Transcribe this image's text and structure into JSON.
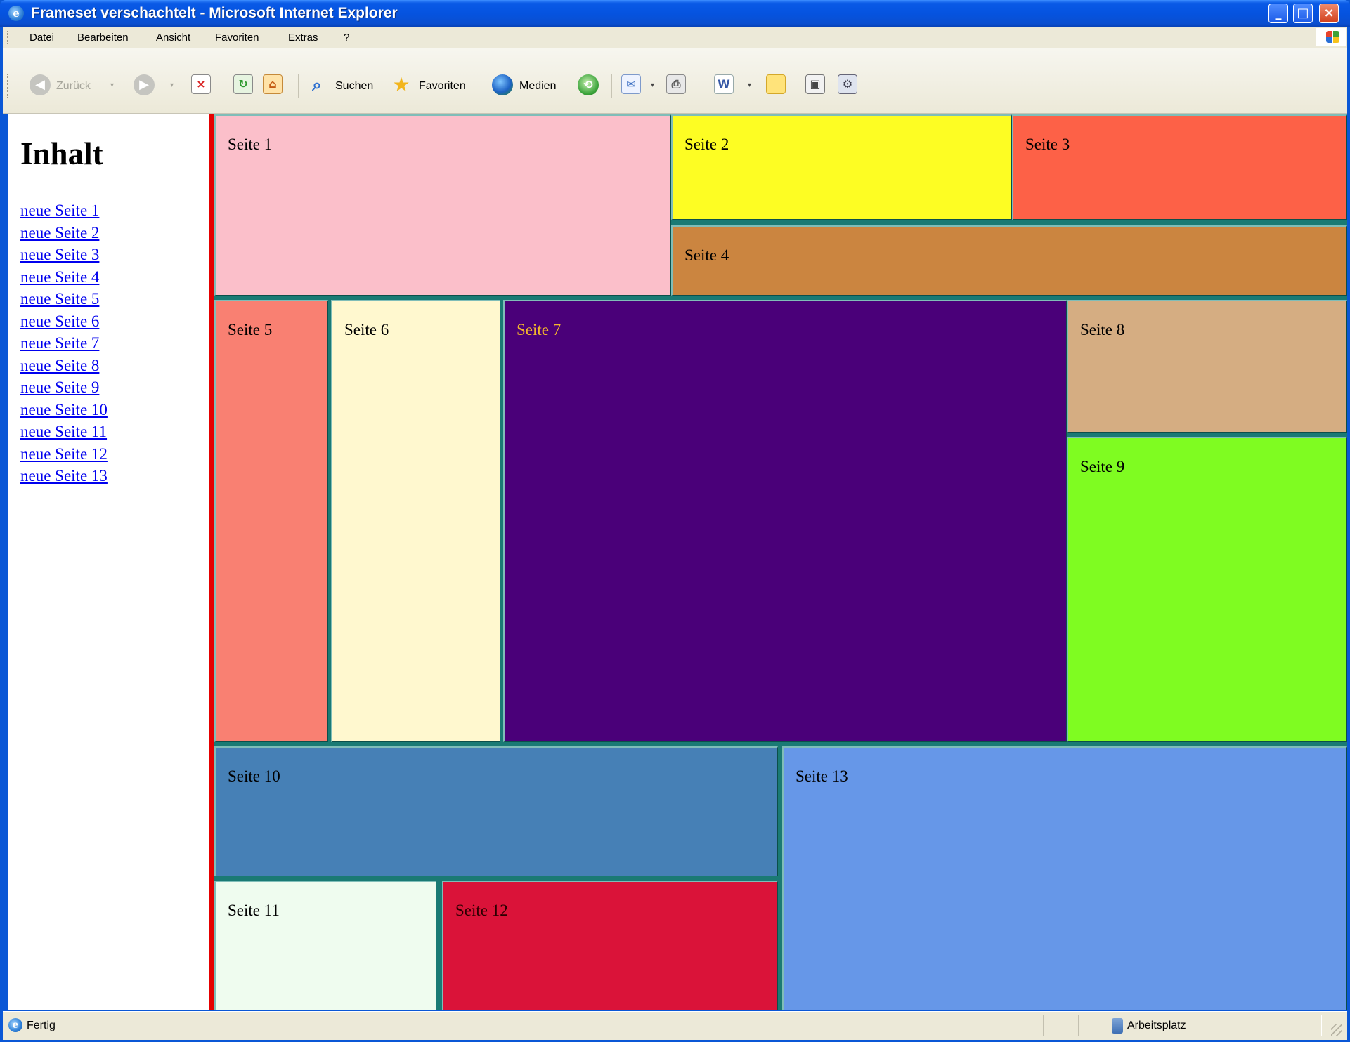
{
  "window": {
    "title": "Frameset verschachtelt - Microsoft Internet Explorer",
    "buttons": {
      "minimize": "_",
      "maximize": "□",
      "close": "×"
    }
  },
  "menu": {
    "items": [
      "Datei",
      "Bearbeiten",
      "Ansicht",
      "Favoriten",
      "Extras",
      "?"
    ]
  },
  "toolbar": {
    "back_label": "Zurück",
    "search_label": "Suchen",
    "favorites_label": "Favoriten",
    "media_label": "Medien"
  },
  "nav": {
    "heading": "Inhalt",
    "links": [
      "neue Seite 1",
      "neue Seite 2",
      "neue Seite 3",
      "neue Seite 4",
      "neue Seite 5",
      "neue Seite 6",
      "neue Seite 7",
      "neue Seite 8",
      "neue Seite 9",
      "neue Seite 10",
      "neue Seite 11",
      "neue Seite 12",
      "neue Seite 13"
    ]
  },
  "frames": [
    {
      "label": "Seite 1",
      "bg": "#fbbfca",
      "fg": "#000000"
    },
    {
      "label": "Seite 2",
      "bg": "#fdfd23",
      "fg": "#000000"
    },
    {
      "label": "Seite 3",
      "bg": "#fd6147",
      "fg": "#000000"
    },
    {
      "label": "Seite 4",
      "bg": "#cb8540",
      "fg": "#000000"
    },
    {
      "label": "Seite 5",
      "bg": "#f98072",
      "fg": "#000000"
    },
    {
      "label": "Seite 6",
      "bg": "#fff8cf",
      "fg": "#000000"
    },
    {
      "label": "Seite 7",
      "bg": "#4a0079",
      "fg": "#f3b62c"
    },
    {
      "label": "Seite 8",
      "bg": "#d5ad82",
      "fg": "#000000"
    },
    {
      "label": "Seite 9",
      "bg": "#7ffc21",
      "fg": "#000000"
    },
    {
      "label": "Seite 10",
      "bg": "#4680b6",
      "fg": "#000000"
    },
    {
      "label": "Seite 11",
      "bg": "#effcef",
      "fg": "#000000"
    },
    {
      "label": "Seite 12",
      "bg": "#da1339",
      "fg": "#2a0000"
    },
    {
      "label": "Seite 13",
      "bg": "#6697e8",
      "fg": "#000000"
    }
  ],
  "status": {
    "text": "Fertig",
    "zone": "Arbeitsplatz"
  },
  "colors": {
    "frame_border": "#1a7a74",
    "nav_divider": "#e50000",
    "link": "#0000ee"
  }
}
